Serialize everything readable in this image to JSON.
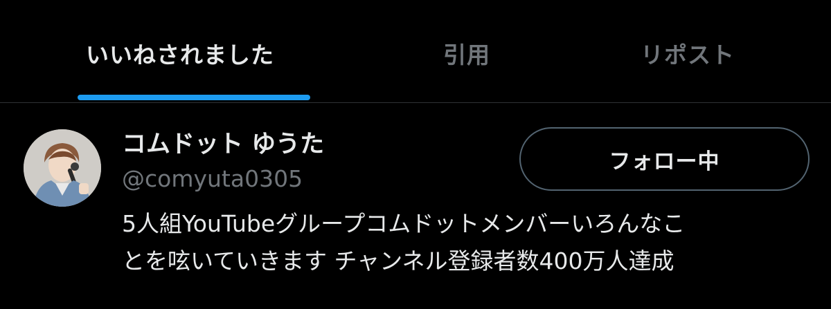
{
  "tabs": [
    {
      "label": "いいねされました",
      "active": true
    },
    {
      "label": "引用",
      "active": false
    },
    {
      "label": "リポスト",
      "active": false
    }
  ],
  "user": {
    "display_name": "コムドット ゆうた",
    "handle": "@comyuta0305",
    "follow_button_label": "フォロー中",
    "bio_lines": [
      "5人組YouTubeグループコムドットメンバーいろんなこ",
      "とを呟いていきます チャンネル登録者数400万人達成"
    ]
  },
  "colors": {
    "background": "#000000",
    "primary_text": "#e7e9ea",
    "secondary_text": "#71767b",
    "accent": "#1d9bf0",
    "divider": "#2f3336",
    "button_border": "#536471"
  }
}
